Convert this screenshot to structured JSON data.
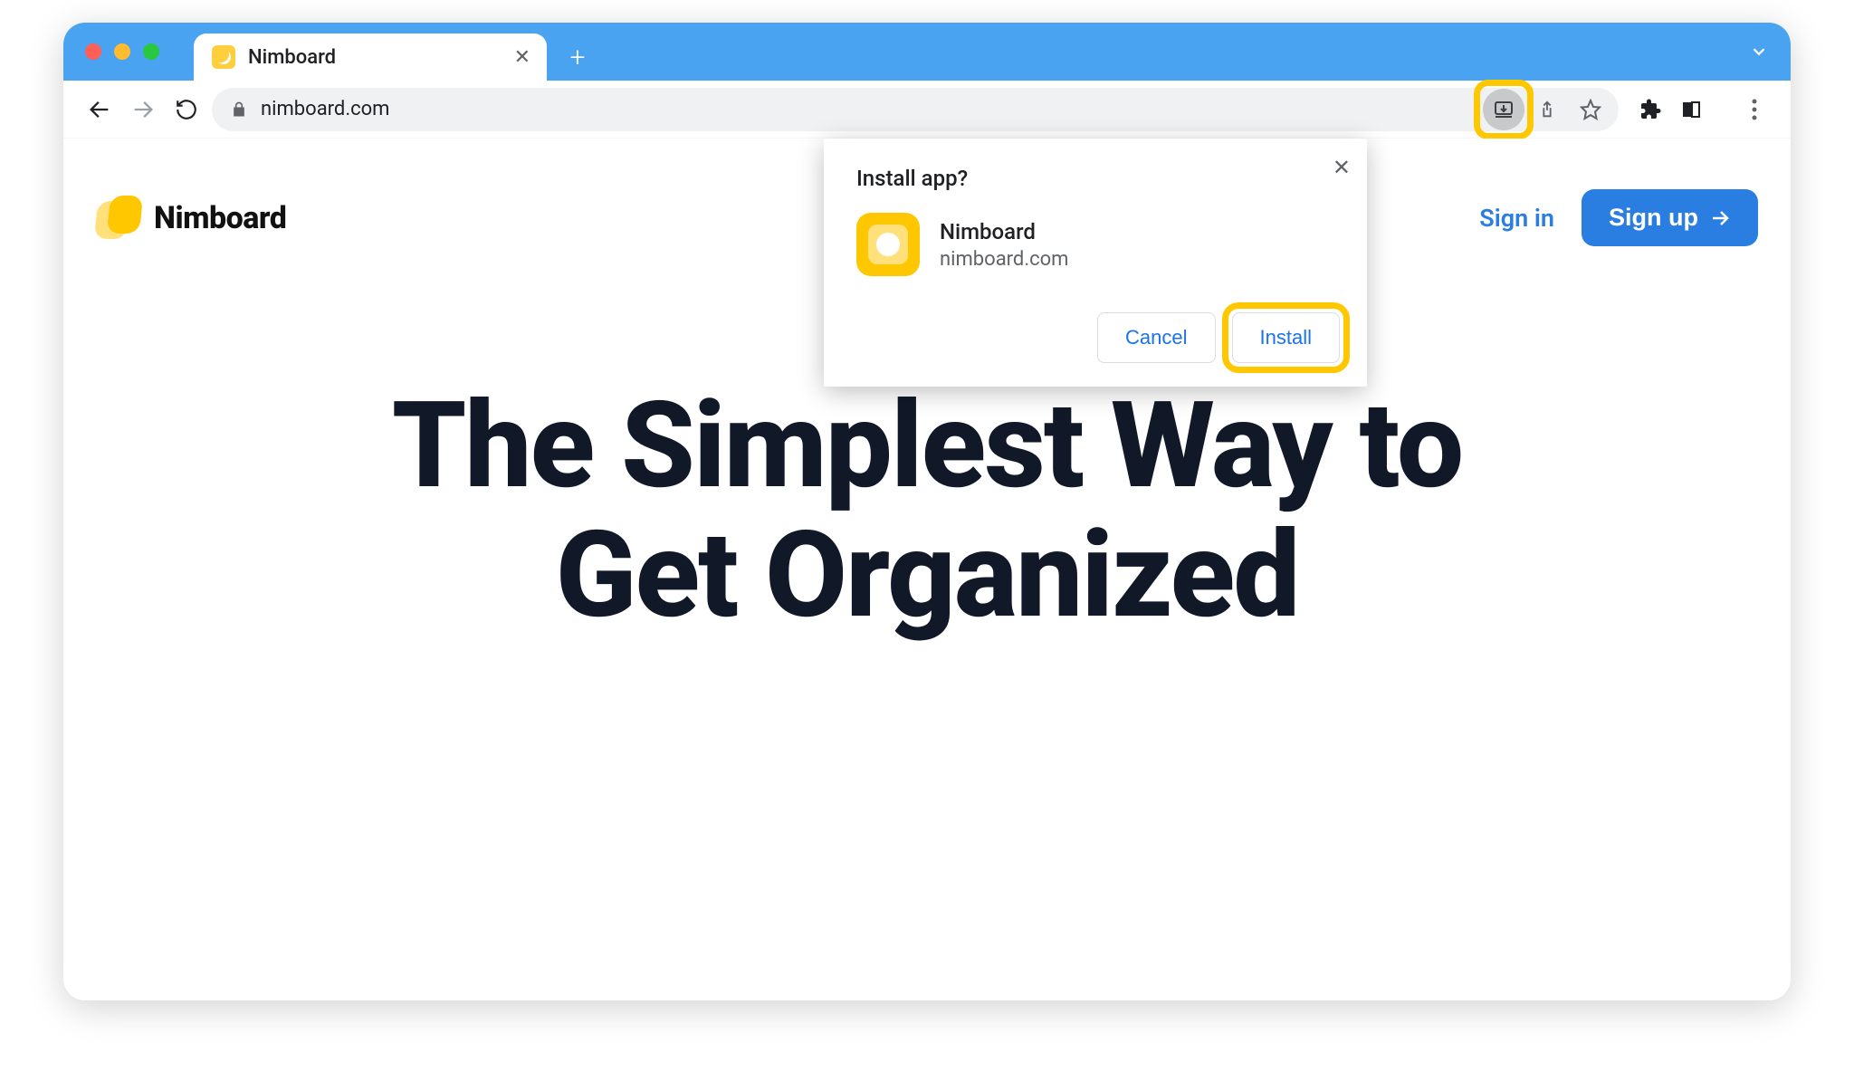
{
  "browser": {
    "tab_title": "Nimboard",
    "url": "nimboard.com"
  },
  "site": {
    "brand": "Nimboard",
    "signin": "Sign in",
    "signup": "Sign up",
    "hero_pre": "The ",
    "hero_highlight": "Simplest",
    "hero_post": " Way to",
    "hero_line2": "Get Organized"
  },
  "install_popup": {
    "title": "Install app?",
    "app_name": "Nimboard",
    "app_domain": "nimboard.com",
    "cancel": "Cancel",
    "install": "Install"
  }
}
